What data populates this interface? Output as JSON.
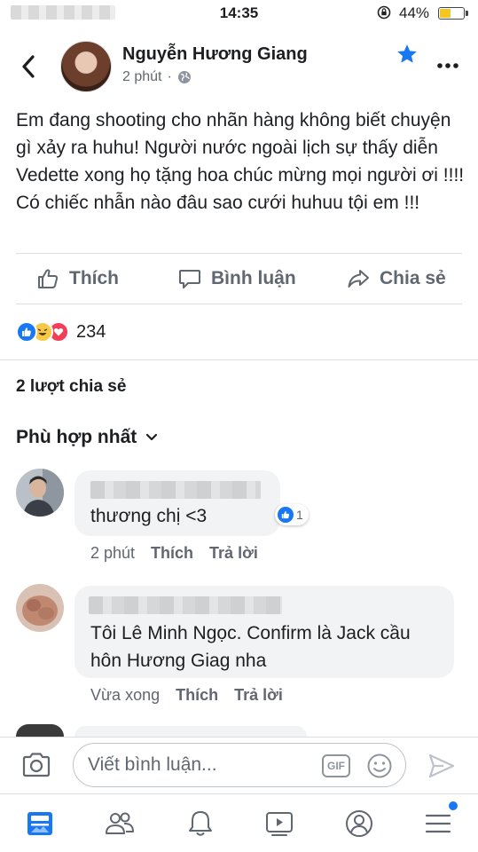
{
  "status_bar": {
    "time": "14:35",
    "battery_percent_label": "44%",
    "battery_level": 0.44,
    "battery_color": "#f3c623"
  },
  "post": {
    "author": "Nguyễn Hương Giang",
    "time": "2 phút",
    "audience_icon": "globe-icon",
    "text": "Em đang shooting cho nhãn hàng không biết chuyện gì xảy ra huhu! Người nước ngoài lịch sự thấy diễn Vedette xong họ tặng hoa chúc mừng mọi người ơi !!!! Có chiếc nhẫn nào đâu sao cưới huhuu tội em !!!",
    "starred_color": "#1877f2"
  },
  "actions": {
    "like": "Thích",
    "comment": "Bình luận",
    "share": "Chia sẻ"
  },
  "reactions": {
    "types": [
      "like",
      "haha",
      "love"
    ],
    "count": "234"
  },
  "shares_label": "2 lượt chia sẻ",
  "sort_label": "Phù hợp nhất",
  "comments": [
    {
      "text": "thương chị <3",
      "time": "2 phút",
      "like_label": "Thích",
      "reply_label": "Trả lời",
      "like_count": "1"
    },
    {
      "text": "Tôi Lê Minh Ngọc. Confirm là Jack cầu hôn Hương Giag nha",
      "time": "Vừa xong",
      "like_label": "Thích",
      "reply_label": "Trả lời"
    }
  ],
  "composer": {
    "placeholder": "Viết bình luận...",
    "gif_label": "GIF"
  },
  "tab_bar": {
    "tabs": [
      "news-feed-icon",
      "friends-icon",
      "notifications-icon",
      "watch-icon",
      "profile-icon",
      "menu-icon"
    ],
    "active_color": "#1877f2"
  },
  "colors": {
    "accent": "#1877f2",
    "secondary_text": "#606770",
    "bubble": "#f2f3f5"
  }
}
